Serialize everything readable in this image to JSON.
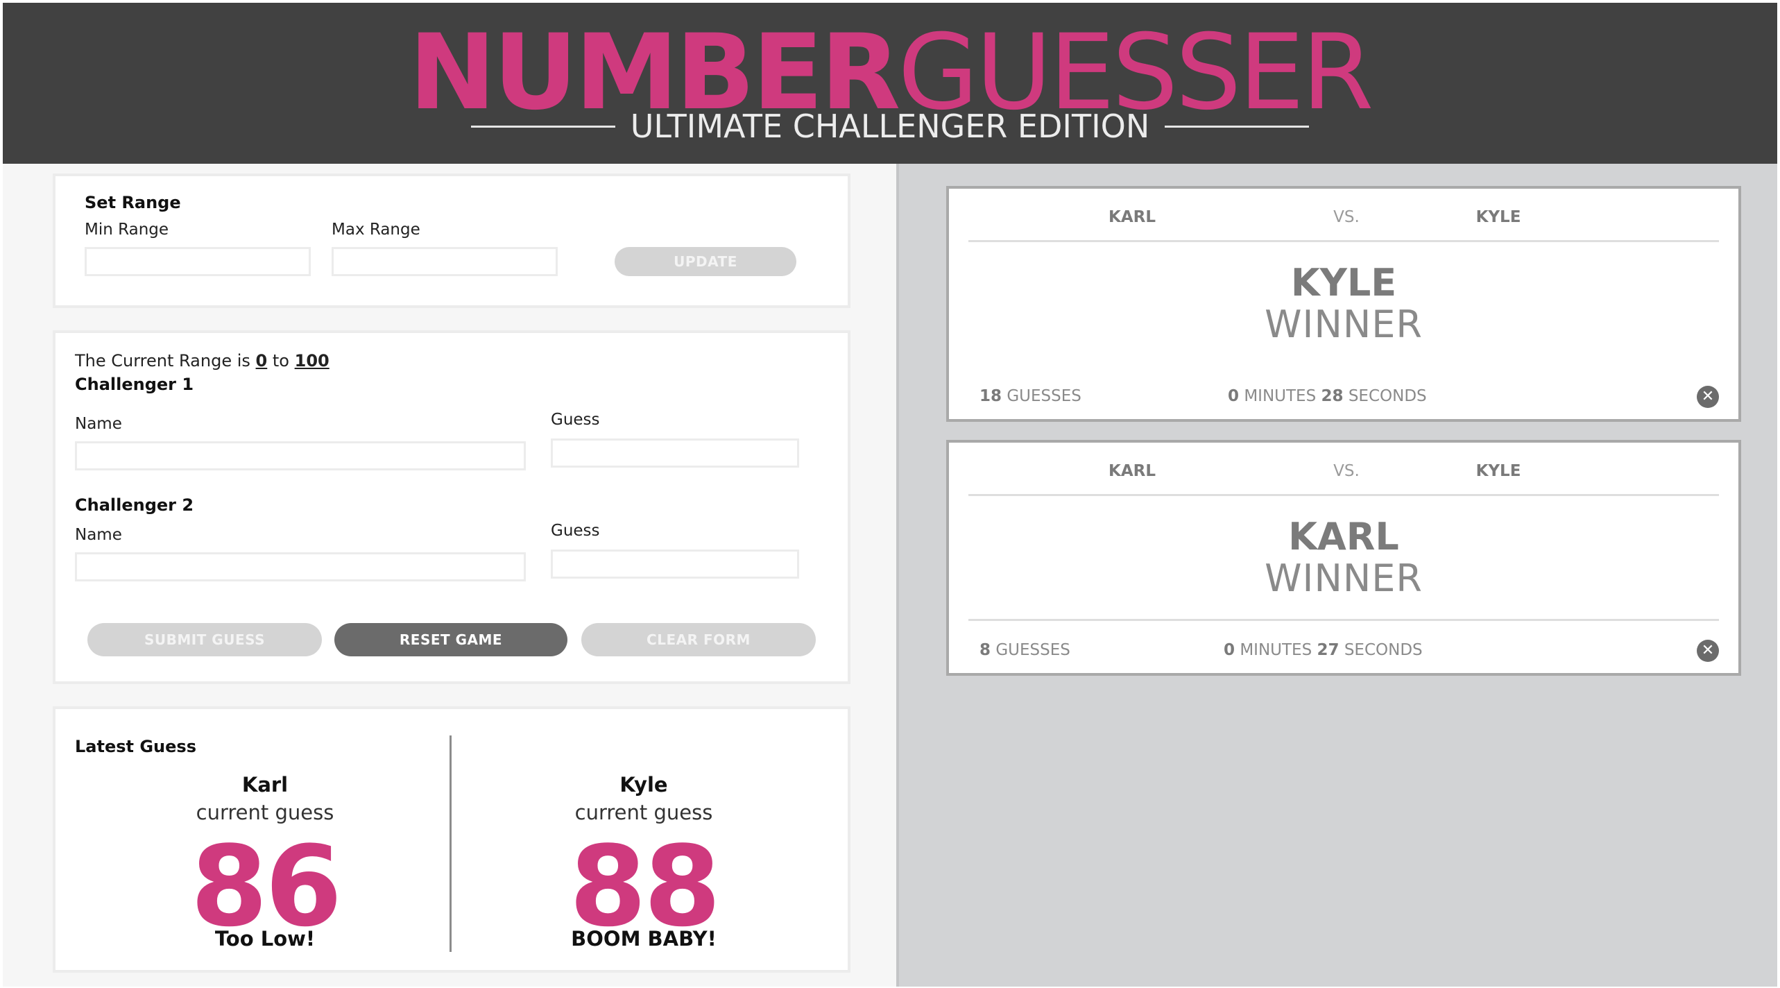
{
  "header": {
    "logo_bold": "NUMBER",
    "logo_light": "GUESSER",
    "subtitle": "ULTIMATE CHALLENGER EDITION"
  },
  "set_range": {
    "title": "Set Range",
    "min_label": "Min Range",
    "max_label": "Max Range",
    "min_value": "",
    "max_value": "",
    "update_label": "UPDATE"
  },
  "game": {
    "range_prefix": "The Current Range is",
    "range_min": "0",
    "range_joiner": "to",
    "range_max": "100",
    "challenger1": {
      "title": "Challenger 1",
      "name_label": "Name",
      "guess_label": "Guess",
      "name_value": "",
      "guess_value": ""
    },
    "challenger2": {
      "title": "Challenger 2",
      "name_label": "Name",
      "guess_label": "Guess",
      "name_value": "",
      "guess_value": ""
    },
    "submit_label": "SUBMIT GUESS",
    "reset_label": "RESET GAME",
    "clear_label": "CLEAR FORM"
  },
  "latest_guess": {
    "title": "Latest Guess",
    "players": [
      {
        "name": "Karl",
        "subtitle": "current guess",
        "guess": "86",
        "feedback": "Too Low!"
      },
      {
        "name": "Kyle",
        "subtitle": "current guess",
        "guess": "88",
        "feedback": "BOOM BABY!"
      }
    ]
  },
  "results": [
    {
      "player1": "KARL",
      "vs": "VS.",
      "player2": "KYLE",
      "winner": "KYLE",
      "winner_label": "WINNER",
      "guesses_count": "18",
      "guesses_label": "GUESSES",
      "minutes": "0",
      "minutes_label": "MINUTES",
      "seconds": "28",
      "seconds_label": "SECONDS"
    },
    {
      "player1": "KARL",
      "vs": "VS.",
      "player2": "KYLE",
      "winner": "KARL",
      "winner_label": "WINNER",
      "guesses_count": "8",
      "guesses_label": "GUESSES",
      "minutes": "0",
      "minutes_label": "MINUTES",
      "seconds": "27",
      "seconds_label": "SECONDS"
    }
  ],
  "icons": {
    "close": "close-circle-icon"
  },
  "colors": {
    "brand_pink": "#cf3a7e",
    "header_bg": "#414141",
    "right_bg": "#d2d3d5"
  }
}
